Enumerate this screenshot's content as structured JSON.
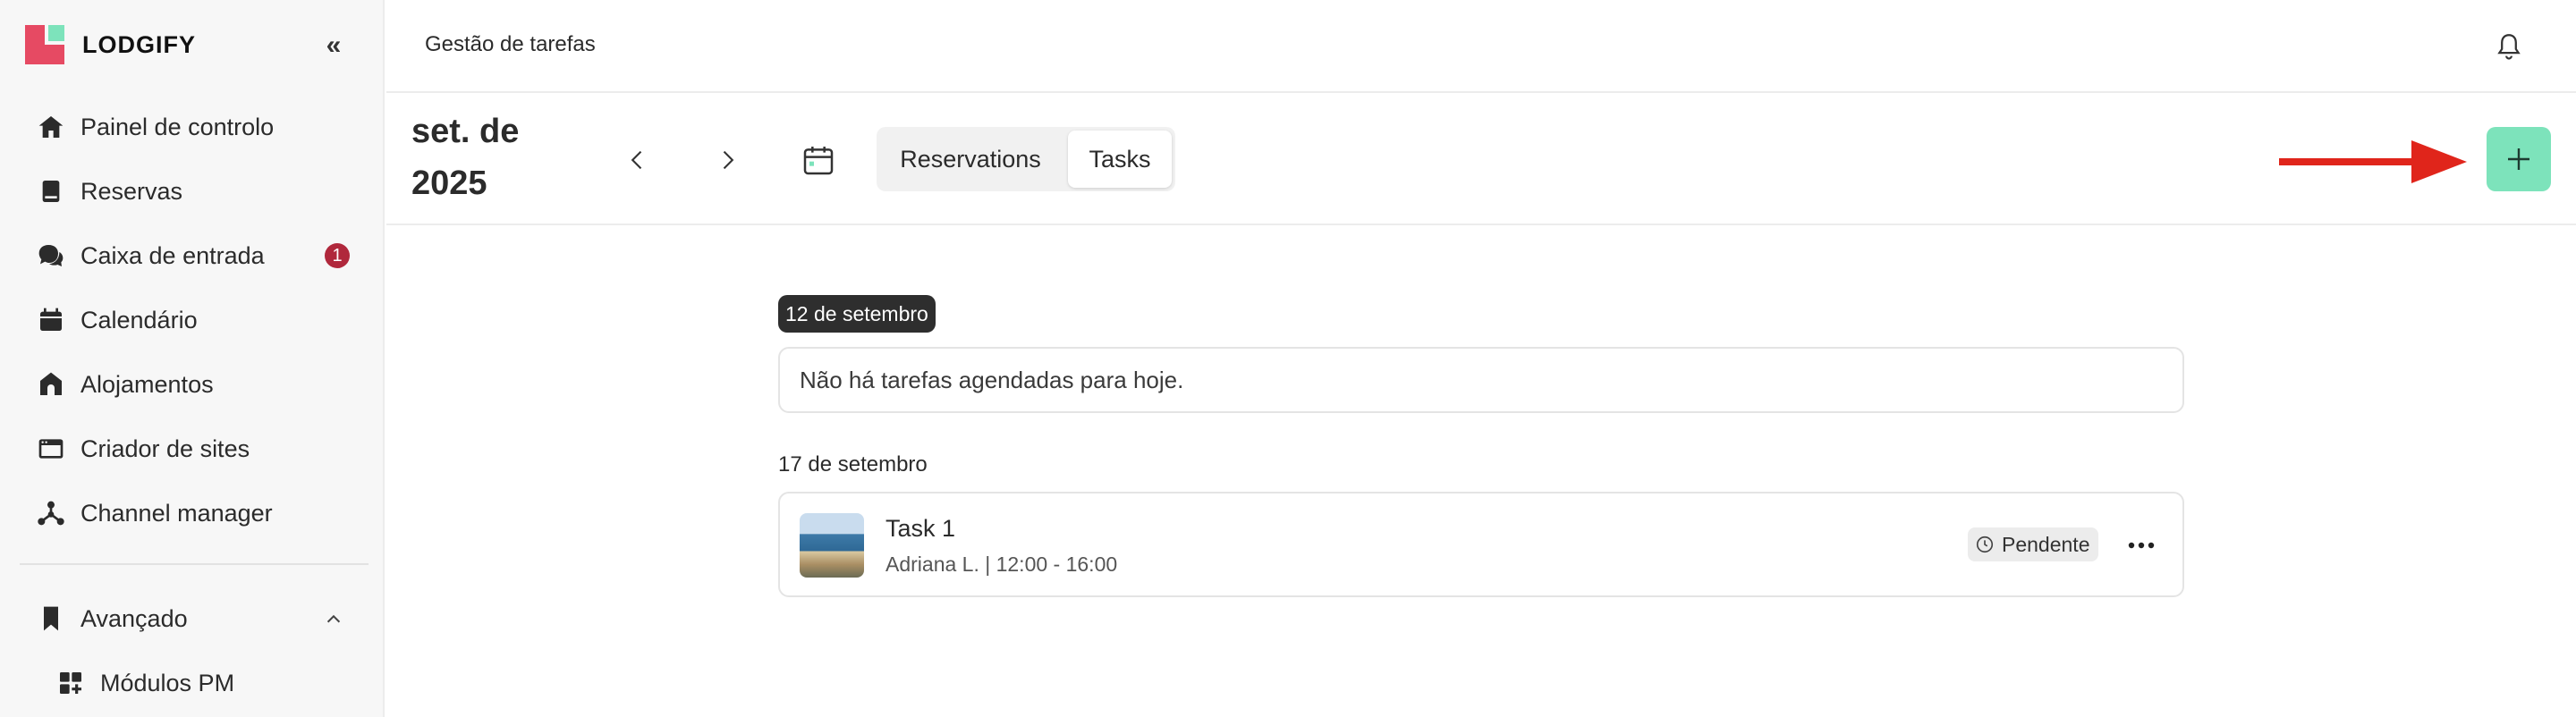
{
  "brand": {
    "name": "LODGIFY",
    "colors": {
      "red": "#e64a63",
      "mint": "#7de3bb"
    }
  },
  "sidebar": {
    "collapse_icon": "double-chevron-left-icon",
    "items": [
      {
        "label": "Painel de controlo",
        "icon": "home-icon"
      },
      {
        "label": "Reservas",
        "icon": "book-icon"
      },
      {
        "label": "Caixa de entrada",
        "icon": "chat-icon",
        "badge": "1"
      },
      {
        "label": "Calendário",
        "icon": "calendar-icon"
      },
      {
        "label": "Alojamentos",
        "icon": "house-icon"
      },
      {
        "label": "Criador de sites",
        "icon": "browser-icon"
      },
      {
        "label": "Channel manager",
        "icon": "network-icon"
      }
    ],
    "advanced": {
      "label": "Avançado",
      "icon": "bookmark-icon",
      "expanded": true
    },
    "submodules": [
      {
        "label": "Módulos PM",
        "icon": "grid-add-icon"
      }
    ]
  },
  "topbar": {
    "title": "Gestão de tarefas",
    "icon": "bell-icon"
  },
  "toolbar": {
    "period_line1": "set. de",
    "period_line2": "2025",
    "tabs": [
      {
        "label": "Reservations",
        "active": false
      },
      {
        "label": "Tasks",
        "active": true
      }
    ],
    "add_button_icon": "plus-icon",
    "annotation": "red-arrow-pointing-to-add-button"
  },
  "schedule": {
    "today": {
      "date": "12 de setembro",
      "empty_message": "Não há tarefas agendadas para hoje."
    },
    "next": {
      "date": "17 de setembro",
      "tasks": [
        {
          "title": "Task 1",
          "meta": "Adriana L. | 12:00 - 16:00",
          "status": "Pendente",
          "status_icon": "clock-icon",
          "thumbnail": "beach-photo"
        }
      ]
    }
  }
}
